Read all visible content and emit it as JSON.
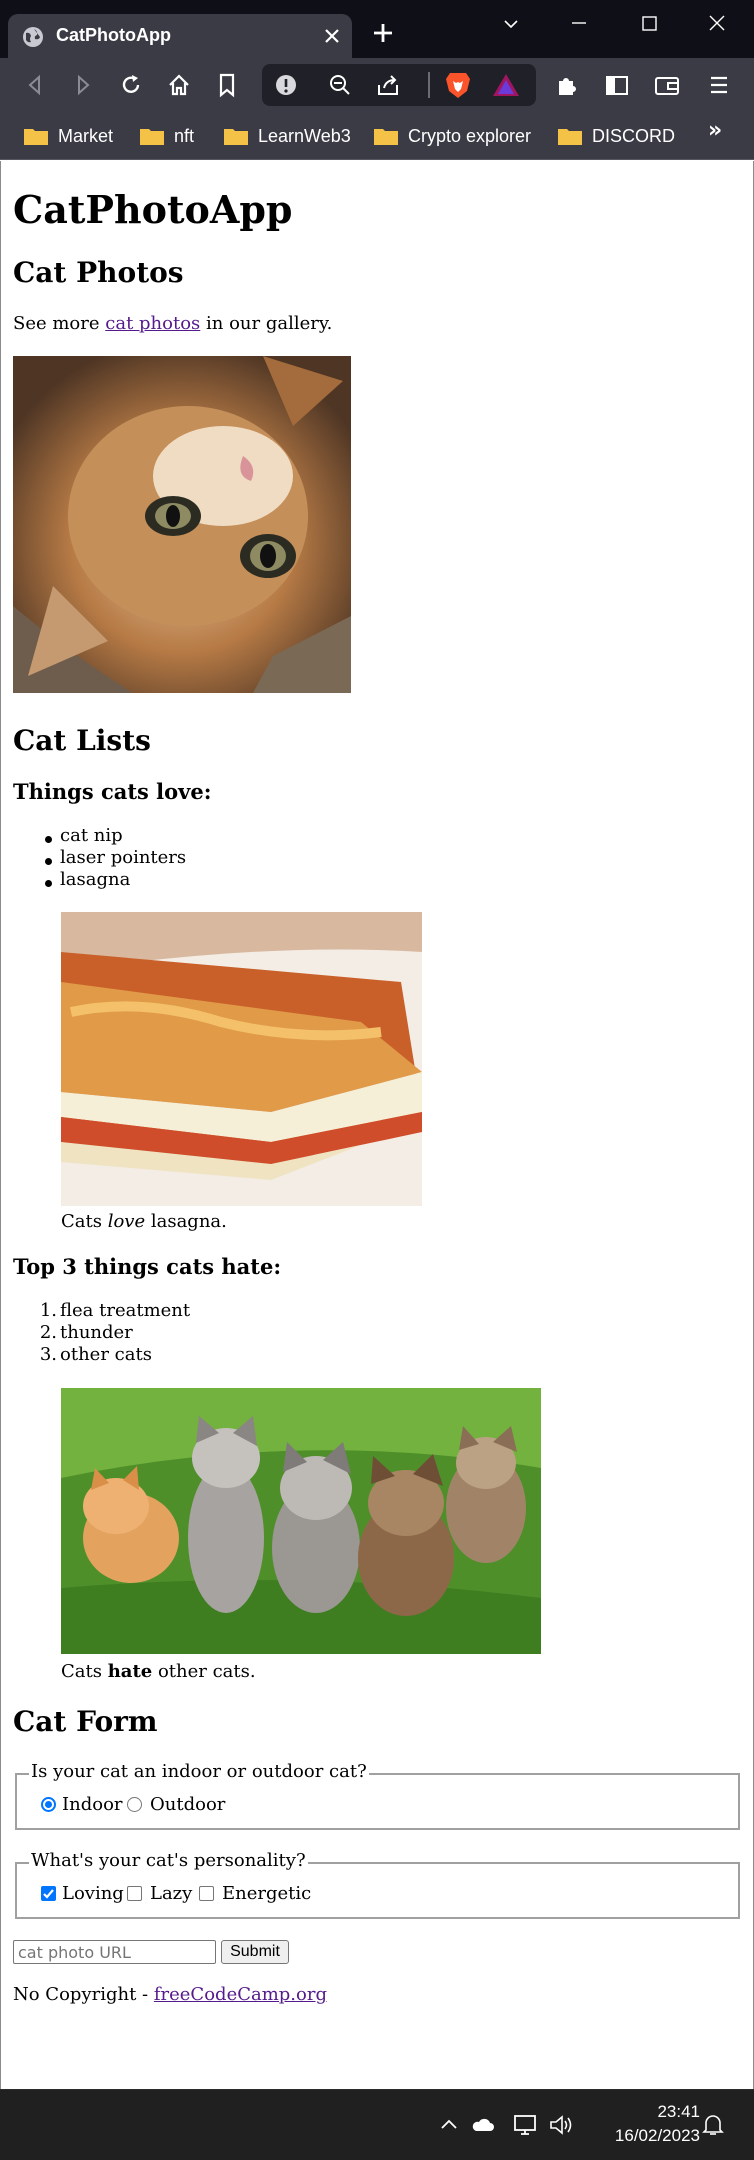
{
  "browser": {
    "tab_title": "CatPhotoApp",
    "bookmarks": [
      "Market",
      "nft",
      "LearnWeb3",
      "Crypto explorer",
      "DISCORD"
    ],
    "bookmarks_overflow": "»"
  },
  "page": {
    "title": "CatPhotoApp",
    "photos_heading": "Cat Photos",
    "gallery_prefix": "See more ",
    "gallery_link": "cat photos",
    "gallery_suffix": " in our gallery.",
    "lists_heading": "Cat Lists",
    "love_heading": "Things cats love:",
    "love_items": [
      "cat nip",
      "laser pointers",
      "lasagna"
    ],
    "love_caption_prefix": "Cats ",
    "love_caption_em": "love",
    "love_caption_suffix": " lasagna.",
    "hate_heading": "Top 3 things cats hate:",
    "hate_items": [
      "flea treatment",
      "thunder",
      "other cats"
    ],
    "hate_numbers": [
      "1.",
      "2.",
      "3."
    ],
    "hate_caption_prefix": "Cats ",
    "hate_caption_strong": "hate",
    "hate_caption_suffix": " other cats.",
    "form_heading": "Cat Form",
    "indoor_legend": "Is your cat an indoor or outdoor cat?",
    "indoor_label": "Indoor",
    "outdoor_label": "Outdoor",
    "personality_legend": "What's your cat's personality?",
    "loving_label": "Loving",
    "lazy_label": "Lazy",
    "energetic_label": "Energetic",
    "url_placeholder": "cat photo URL",
    "submit_label": "Submit",
    "footer_prefix": "No Copyright - ",
    "footer_link": "freeCodeCamp.org",
    "selected_location": "Indoor",
    "checked_personality": [
      "Loving"
    ]
  },
  "taskbar": {
    "time": "23:41",
    "date": "16/02/2023"
  },
  "colors": {
    "accent": "#0075ff",
    "visited_link": "#551a8b",
    "chrome_bg": "#3a3b45",
    "titlebar_bg": "#0f0f17",
    "taskbar_bg": "#202020"
  },
  "icons": [
    "globe-icon",
    "close-icon",
    "plus-icon",
    "back-icon",
    "forward-icon",
    "reload-icon",
    "home-icon",
    "bookmark-icon",
    "info-icon",
    "zoom-out-icon",
    "share-icon",
    "brave-lion-icon",
    "rewards-triangle-icon",
    "extensions-icon",
    "sidebar-icon",
    "wallet-icon",
    "menu-icon",
    "folder-icon",
    "chevron-up-icon",
    "cloud-icon",
    "network-icon",
    "volume-icon",
    "notification-icon"
  ]
}
